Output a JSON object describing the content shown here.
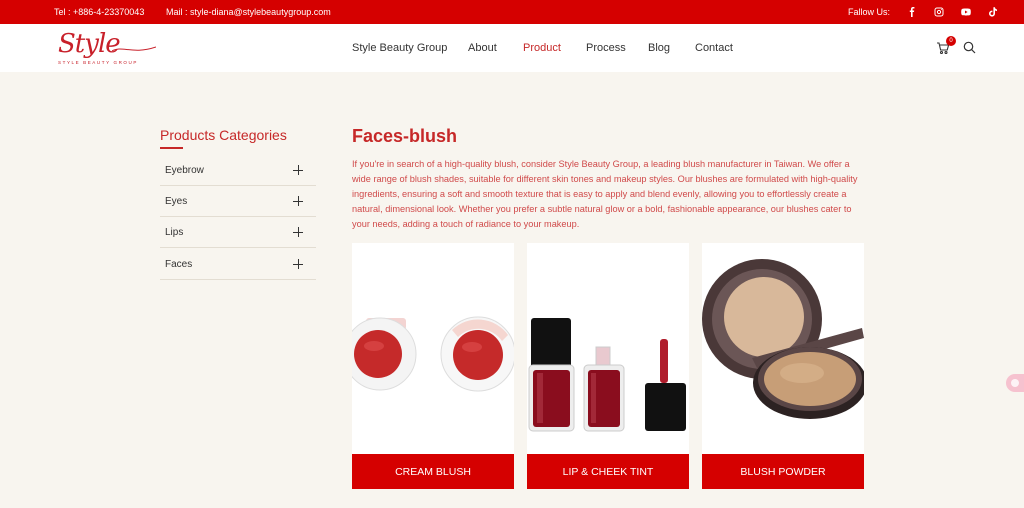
{
  "topbar": {
    "tel": "Tel : +886-4-23370043",
    "mail": "Mail : style-diana@stylebeautygroup.com",
    "follow": "Fallow Us:",
    "social_icons": [
      "facebook-icon",
      "instagram-icon",
      "youtube-icon",
      "tiktok-icon"
    ]
  },
  "header": {
    "logo_script": "Style",
    "logo_tagline": "STYLE BEAUTY GROUP",
    "nav": [
      "Style Beauty Group",
      "About",
      "Product",
      "Process",
      "Blog",
      "Contact"
    ],
    "active_nav": "Product",
    "cart_count": "0"
  },
  "sidebar": {
    "title": "Products Categories",
    "items": [
      "Eyebrow",
      "Eyes",
      "Lips",
      "Faces"
    ]
  },
  "main": {
    "title": "Faces-blush",
    "description": "If you're in search of a high-quality blush, consider Style Beauty Group, a leading blush manufacturer in Taiwan. We offer a wide range of blush shades, suitable for different skin tones and makeup styles. Our blushes are formulated with high-quality ingredients, ensuring a soft and smooth texture that is easy to apply and blend evenly, allowing you to effortlessly create a natural, dimensional look. Whether you prefer a subtle natural glow or a bold, fashionable appearance, our blushes cater to your needs, adding a touch of radiance to your makeup.",
    "products": [
      {
        "label": "CREAM BLUSH"
      },
      {
        "label": "LIP & CHEEK TINT"
      },
      {
        "label": "BLUSH POWDER"
      }
    ]
  },
  "colors": {
    "brand_red": "#d50000",
    "text_red": "#c62828",
    "page_bg": "#f8f5ef"
  }
}
